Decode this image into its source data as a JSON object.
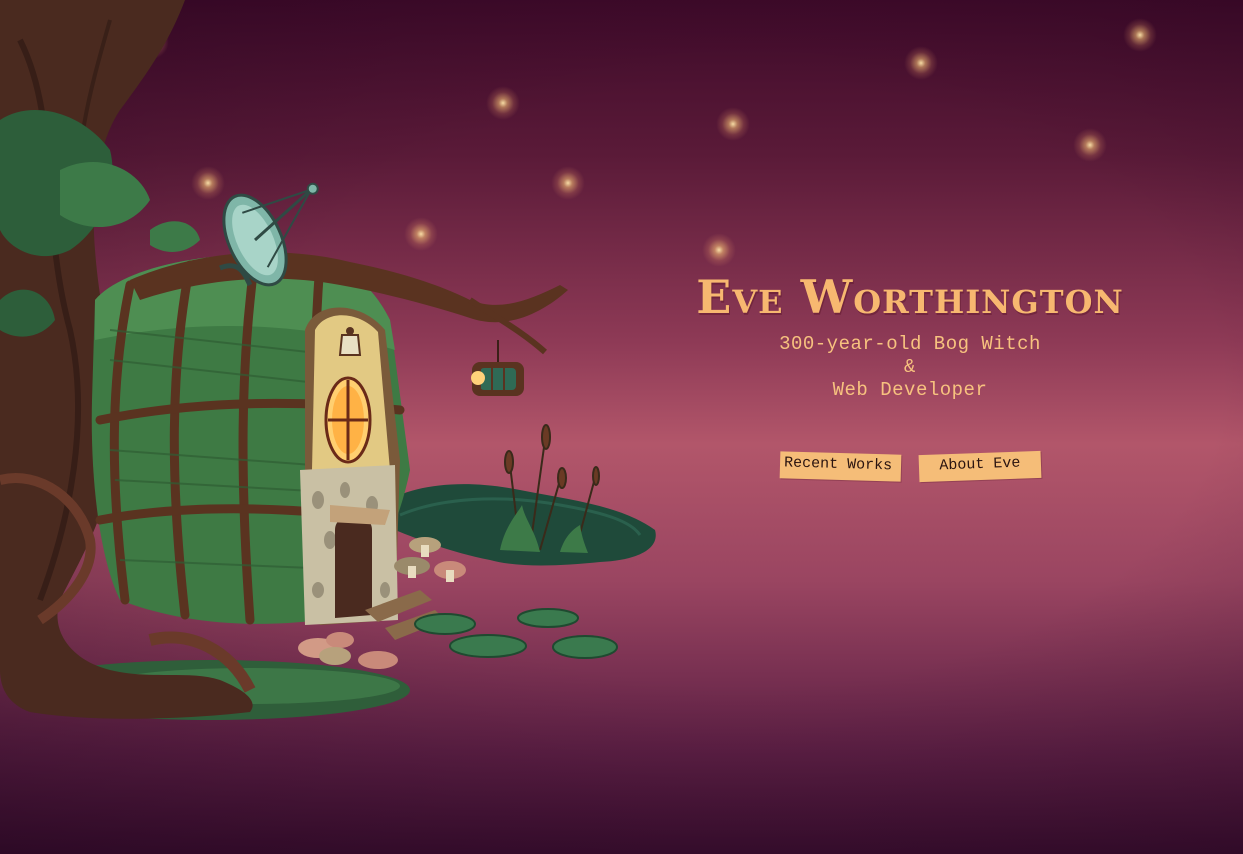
{
  "hero": {
    "title": "Eve Worthington",
    "subtitle_line1": "300-year-old Bog Witch",
    "subtitle_line2": "&",
    "subtitle_line3": "Web Developer"
  },
  "nav": {
    "recent_works_label": "Recent Works",
    "about_label": "About Eve"
  },
  "colors": {
    "accent": "#f7b870",
    "tag_background": "#f5bd78",
    "background_top": "#3f0a2a",
    "background_mid": "#b2566a",
    "background_bottom": "#3a0e2f"
  },
  "illustration": {
    "subject": "witch-bog-hut-illustration",
    "elements": [
      "tree",
      "moss-hut",
      "satellite-dish",
      "lantern",
      "round-window",
      "pond",
      "cattails",
      "lily-pads",
      "mushrooms"
    ]
  },
  "icons": [
    "firefly-glow"
  ]
}
